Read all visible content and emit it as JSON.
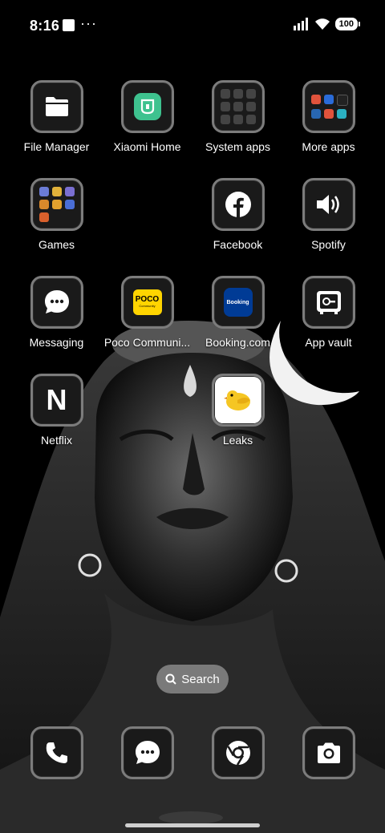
{
  "status_bar": {
    "time": "8:16",
    "dots": "···",
    "battery": "100"
  },
  "apps": {
    "file_manager": "File Manager",
    "xiaomi_home": "Xiaomi Home",
    "system_apps": "System apps",
    "more_apps": "More apps",
    "games": "Games",
    "facebook": "Facebook",
    "spotify": "Spotify",
    "messaging": "Messaging",
    "poco_community": "Poco Communi...",
    "booking": "Booking.com",
    "app_vault": "App vault",
    "netflix": "Netflix",
    "leaks": "Leaks"
  },
  "icon_text": {
    "poco": "POCO",
    "poco_sub": "Community",
    "booking": "Booking",
    "netflix": "N"
  },
  "search": {
    "label": "Search"
  },
  "colors": {
    "xiaomi_green": "#3ec28f",
    "poco_yellow": "#ffd400",
    "booking_blue": "#003b95",
    "leaks_yellow": "#f5c623"
  }
}
